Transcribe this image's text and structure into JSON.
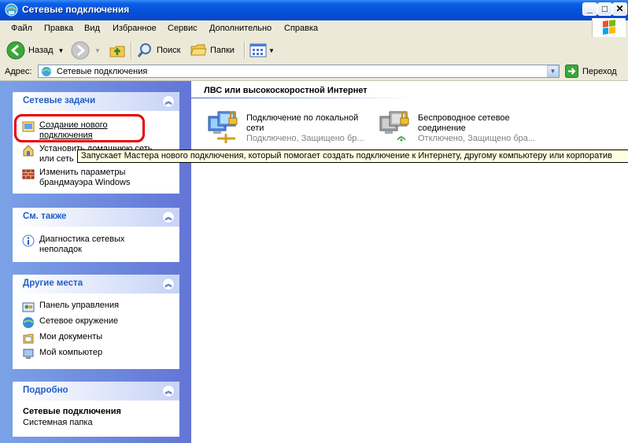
{
  "window": {
    "title": "Сетевые подключения"
  },
  "caption_buttons": {
    "minimize": "_",
    "maximize": "□",
    "close": "✕"
  },
  "menu": [
    "Файл",
    "Правка",
    "Вид",
    "Избранное",
    "Сервис",
    "Дополнительно",
    "Справка"
  ],
  "toolbar": {
    "back": "Назад",
    "search": "Поиск",
    "folders": "Папки"
  },
  "address": {
    "label": "Адрес:",
    "value": "Сетевые подключения",
    "go": "Переход"
  },
  "panels": {
    "tasks": {
      "title": "Сетевые задачи",
      "items": [
        {
          "line1": "Создание нового",
          "line2": "подключения",
          "icon": "new-connection-icon"
        },
        {
          "line1": "Установить домашнюю сеть",
          "line2": "или сеть",
          "icon": "home-network-icon"
        },
        {
          "line1": "Изменить параметры",
          "line2": "брандмауэра Windows",
          "icon": "firewall-icon"
        }
      ]
    },
    "see_also": {
      "title": "См. также",
      "items": [
        {
          "line1": "Диагностика сетевых",
          "line2": "неполадок",
          "icon": "info-icon"
        }
      ]
    },
    "other_places": {
      "title": "Другие места",
      "items": [
        {
          "label": "Панель управления",
          "icon": "control-panel-icon"
        },
        {
          "label": "Сетевое окружение",
          "icon": "network-places-icon"
        },
        {
          "label": "Мои документы",
          "icon": "my-documents-icon"
        },
        {
          "label": "Мой компьютер",
          "icon": "my-computer-icon"
        }
      ]
    },
    "details": {
      "title": "Подробно",
      "name": "Сетевые подключения",
      "type": "Системная папка"
    }
  },
  "content": {
    "section_title": "ЛВС или высокоскоростной Интернет",
    "connections": [
      {
        "name1": "Подключение по локальной",
        "name2": "сети",
        "status": "Подключено, Защищено бр...",
        "icon": "lan-connection-icon"
      },
      {
        "name1": "Беспроводное сетевое",
        "name2": "соединение",
        "status": "Отключено, Защищено бра...",
        "icon": "wireless-connection-icon"
      }
    ]
  },
  "tooltip": "Запускает Мастера нового подключения, который помогает создать подключение к Интернету, другому компьютеру или корпоратив",
  "colors": {
    "title_bar": "#0a5fe6",
    "task_pane": "#6375d6",
    "panel_header_text": "#215dc6",
    "highlight": "#e80000"
  }
}
